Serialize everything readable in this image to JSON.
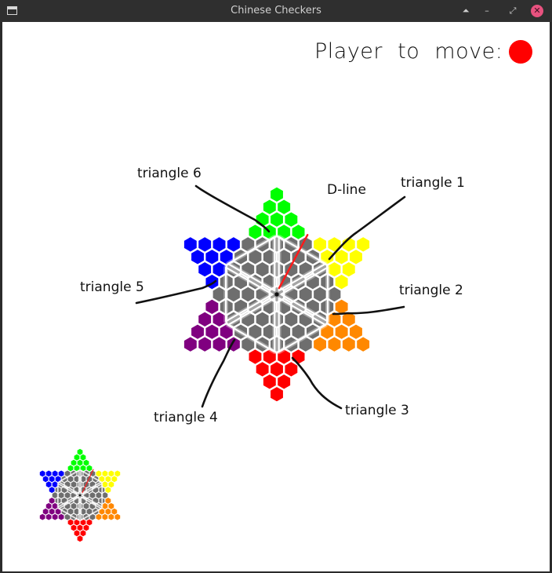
{
  "window": {
    "title": "Chinese Checkers"
  },
  "titlebar_buttons": [
    {
      "name": "shade-icon",
      "glyph": "⏶"
    },
    {
      "name": "minimize-icon",
      "glyph": "–"
    },
    {
      "name": "restore-icon",
      "glyph": "⤢"
    },
    {
      "name": "close-icon",
      "glyph": "✕"
    }
  ],
  "status": {
    "text": "Player to move:",
    "player_color": "#ff0000"
  },
  "board": {
    "center_color": "#6e6e6e",
    "points": {
      "top": "#00ff00",
      "upper_right": "#ffff00",
      "lower_right": "#ff8800",
      "bottom": "#ff0000",
      "lower_left": "#800080",
      "upper_left": "#0000ff"
    }
  },
  "annotations": [
    {
      "id": "triangle-1",
      "label": "triangle 1"
    },
    {
      "id": "triangle-2",
      "label": "triangle 2"
    },
    {
      "id": "triangle-3",
      "label": "triangle 3"
    },
    {
      "id": "triangle-4",
      "label": "triangle 4"
    },
    {
      "id": "triangle-5",
      "label": "triangle 5"
    },
    {
      "id": "triangle-6",
      "label": "triangle 6"
    },
    {
      "id": "d-line",
      "label": "D-line"
    }
  ],
  "minimap": {
    "present": true
  }
}
